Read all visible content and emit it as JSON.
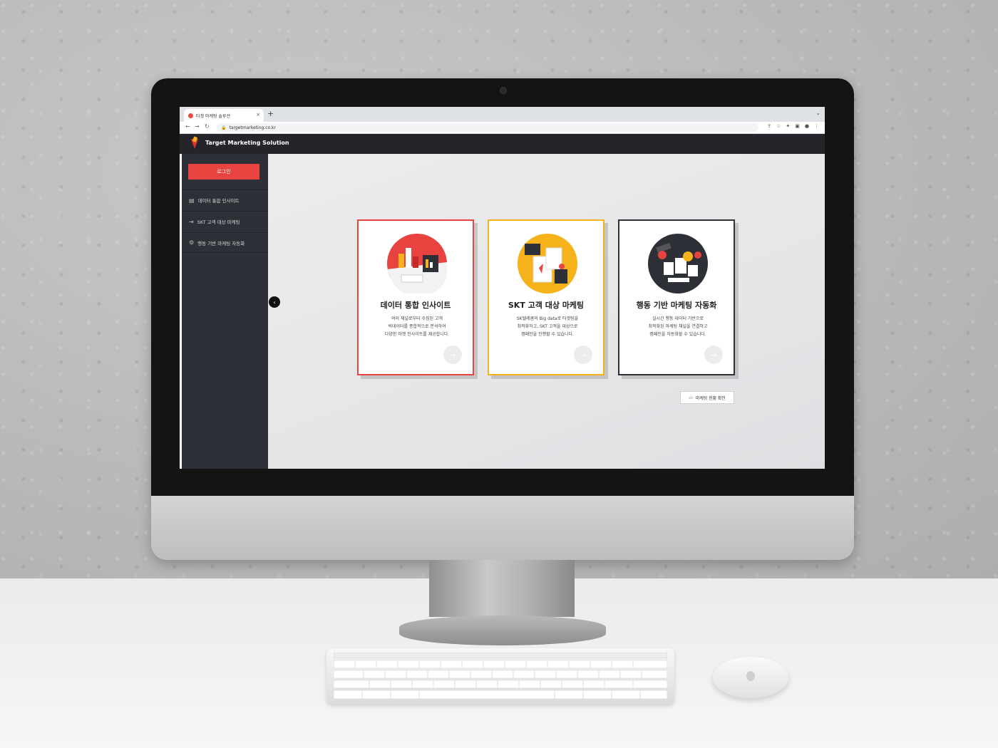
{
  "browser": {
    "tab_title": "타겟 마케팅 솔루션",
    "tab_close": "×",
    "new_tab": "+",
    "url": "targetmarketing.co.kr"
  },
  "app": {
    "brand": "Target Marketing Solution",
    "accent_color": "#e8433f",
    "sidebar": {
      "login_label": "로그인",
      "items": [
        {
          "label": "데이터 통합 인사이트",
          "icon": "chart-icon"
        },
        {
          "label": "SKT 고객 대상 마케팅",
          "icon": "export-icon"
        },
        {
          "label": "행동 기반 마케팅 자동화",
          "icon": "gear-icon"
        }
      ]
    },
    "cards": [
      {
        "title": "데이터 통합 인사이트",
        "desc": "여러 채널로부터 수집된 고객\n빅데이터를 종합적으로 분석하여\n다양한 마켓 인사이트를 제공합니다.",
        "border_color": "#e8433f"
      },
      {
        "title": "SKT 고객 대상 마케팅",
        "desc": "SK텔레콤의 Big data로 타겟팅을\n최적화하고, SKT 고객을 대상으로\n캠페인을 진행할 수 있습니다.",
        "border_color": "#f6b21a"
      },
      {
        "title": "행동 기반 마케팅 자동화",
        "desc": "실시간 행동 데이터 기반으로\n최적화된 마케팅 채널을 연결하고\n캠페인을 자동화할 수 있습니다.",
        "border_color": "#2e3037"
      }
    ],
    "status_button": "마케팅 현황 확인"
  }
}
